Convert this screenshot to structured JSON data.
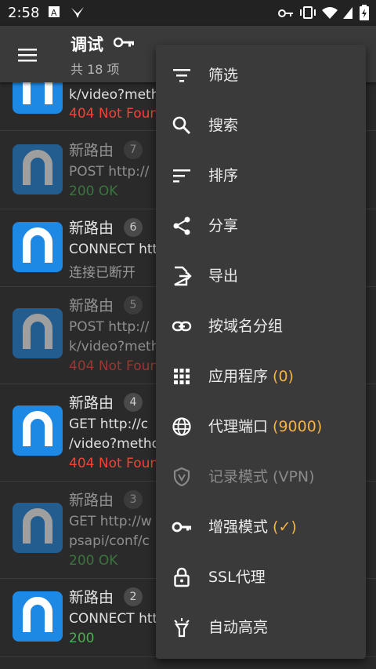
{
  "status": {
    "time": "2:58"
  },
  "appbar": {
    "title": "调试",
    "subtitle": "共 18 项"
  },
  "list": {
    "partial_top": {
      "line2": "k/video?meth",
      "status": "404 Not Foun"
    },
    "items": [
      {
        "name": "新路由",
        "badge": "7",
        "line1": "POST http://",
        "line2": "",
        "status": "200 OK",
        "status_type": "green",
        "dim": true
      },
      {
        "name": "新路由",
        "badge": "6",
        "line1": "CONNECT htt",
        "line2": "",
        "status": "连接已断开",
        "status_type": "gray",
        "dim": false
      },
      {
        "name": "新路由",
        "badge": "5",
        "line1": "POST http://",
        "line2": "k/video?meth",
        "status": "404 Not Foun",
        "status_type": "red",
        "dim": true
      },
      {
        "name": "新路由",
        "badge": "4",
        "line1": "GET http://c",
        "line2": "/video?metho",
        "status": "404 Not Foun",
        "status_type": "red",
        "dim": false
      },
      {
        "name": "新路由",
        "badge": "3",
        "line1": "GET http://w",
        "line2": "psapi/conf/c",
        "status": "200 OK",
        "status_type": "green",
        "dim": true
      },
      {
        "name": "新路由",
        "badge": "2",
        "line1": "CONNECT htt",
        "line2": "",
        "status": "200",
        "status_type": "green",
        "dim": false
      }
    ]
  },
  "menu": {
    "items": [
      {
        "label": "筛选",
        "accent": "",
        "icon": "filter-icon"
      },
      {
        "label": "搜索",
        "accent": "",
        "icon": "search-icon"
      },
      {
        "label": "排序",
        "accent": "",
        "icon": "sort-icon"
      },
      {
        "label": "分享",
        "accent": "",
        "icon": "share-icon"
      },
      {
        "label": "导出",
        "accent": "",
        "icon": "export-icon"
      },
      {
        "label": "按域名分组",
        "accent": "",
        "icon": "link-icon"
      },
      {
        "label": "应用程序 ",
        "accent": "(0)",
        "icon": "apps-grid-icon"
      },
      {
        "label": "代理端口 ",
        "accent": "(9000)",
        "icon": "globe-icon"
      },
      {
        "label": "记录模式 ",
        "accent": "(VPN)",
        "icon": "vpn-shield-icon",
        "disabled": true
      },
      {
        "label": "增强模式 ",
        "accent": "(✓)",
        "icon": "key-icon"
      },
      {
        "label": "SSL代理",
        "accent": "",
        "icon": "lock-icon"
      },
      {
        "label": "自动高亮",
        "accent": "",
        "icon": "highlight-lamp-icon"
      }
    ]
  },
  "colors": {
    "accent": "#f5b342",
    "error": "#f44336",
    "success": "#4caf50",
    "app_icon": "#1e88e5"
  }
}
